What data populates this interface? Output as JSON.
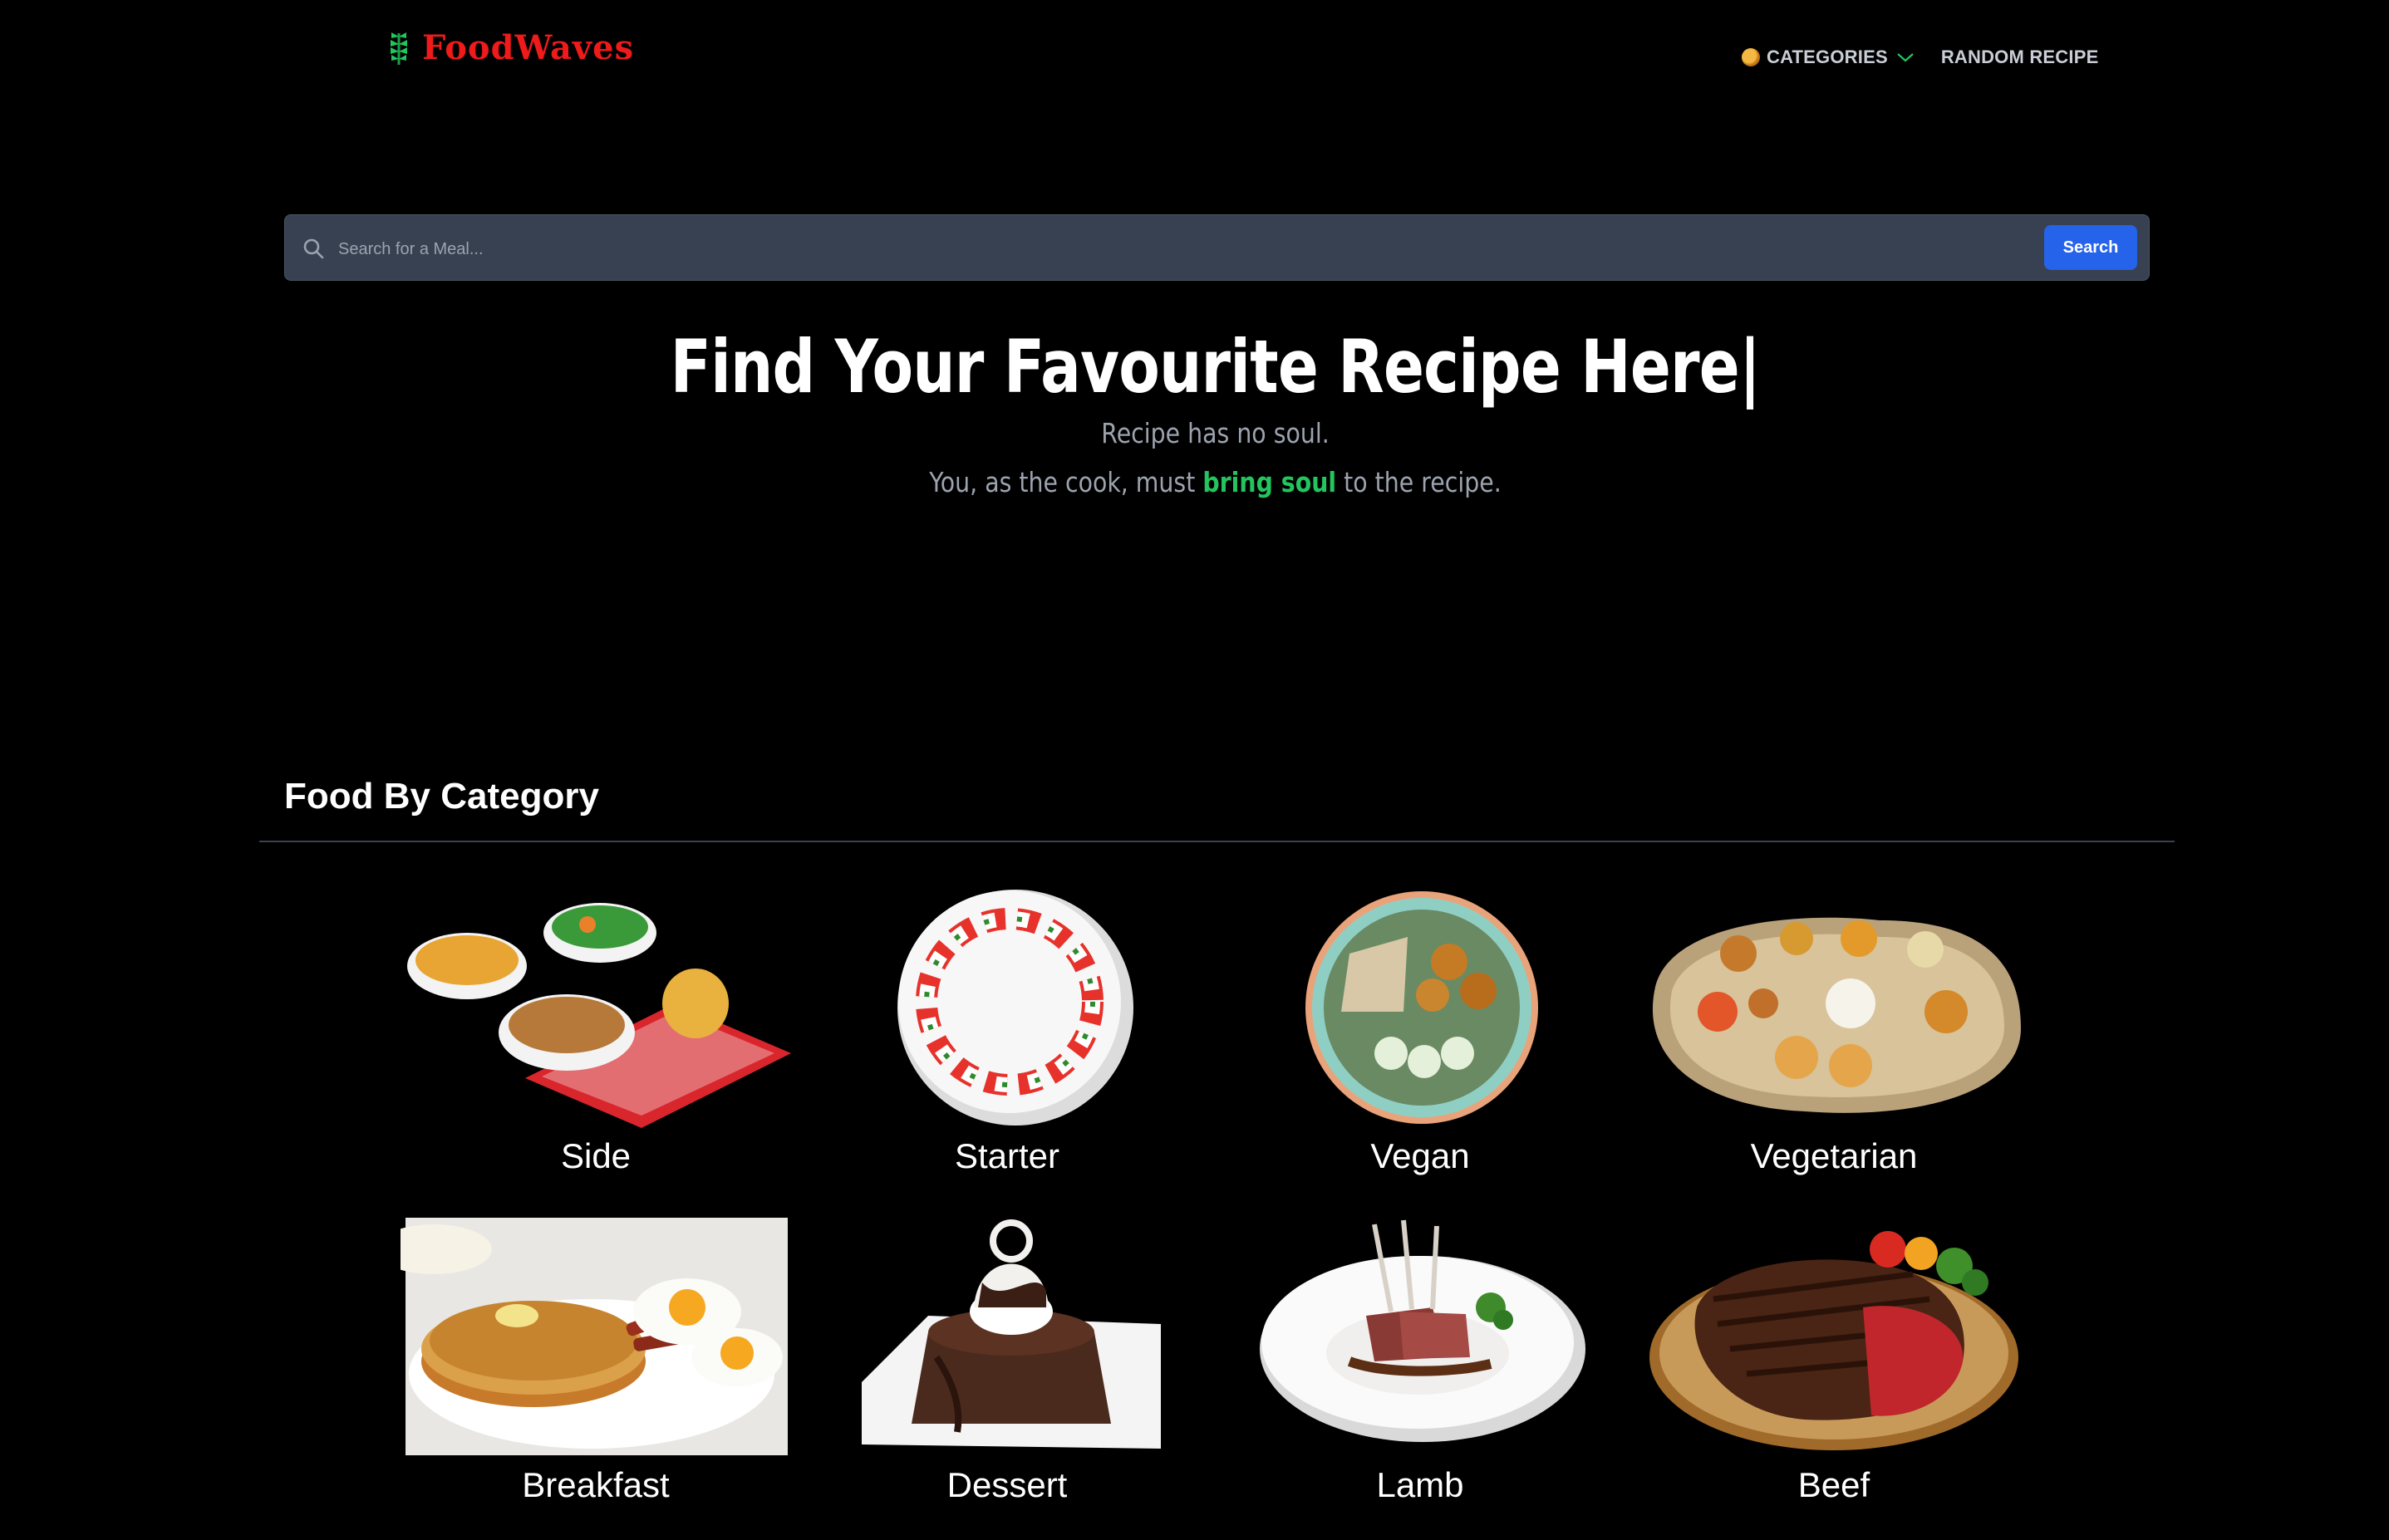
{
  "header": {
    "logo_text": "FoodWaves",
    "nav": {
      "categories_label": "CATEGORIES",
      "random_label": "RANDOM RECIPE"
    }
  },
  "search": {
    "placeholder": "Search for a Meal...",
    "value": "",
    "button_label": "Search"
  },
  "hero": {
    "title": "Find Your Favourite Recipe Here|",
    "line1": "Recipe has no soul.",
    "line2_before": "You, as the cook, must ",
    "line2_accent": "bring soul",
    "line2_after": " to the recipe."
  },
  "categories_section": {
    "title": "Food By Category",
    "items": [
      {
        "label": "Side"
      },
      {
        "label": "Starter"
      },
      {
        "label": "Vegan"
      },
      {
        "label": "Vegetarian"
      },
      {
        "label": "Breakfast"
      },
      {
        "label": "Dessert"
      },
      {
        "label": "Lamb"
      },
      {
        "label": "Beef"
      }
    ]
  },
  "colors": {
    "background": "#000000",
    "logo_red": "#ef1a1a",
    "accent_green": "#22c55e",
    "search_bg": "#374151",
    "button_blue": "#2563eb"
  }
}
